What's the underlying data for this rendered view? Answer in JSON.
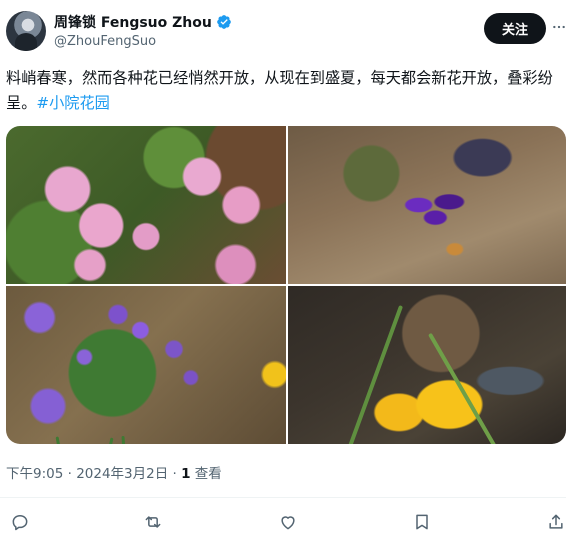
{
  "tweet": {
    "author": {
      "display_name": "周锋锁 Fengsuo Zhou",
      "handle": "@ZhouFengSuo",
      "verified": true
    },
    "follow_label": "关注",
    "text_before_hashtag": "料峭春寒，然而各种花已经悄然开放，从现在到盛夏，每天都会新花开放，叠彩纷呈。",
    "hashtag": "#小院花园",
    "media": [
      {
        "icon": "pink-hellebore-photo"
      },
      {
        "icon": "purple-crocus-photo"
      },
      {
        "icon": "purple-crocus-cluster-photo"
      },
      {
        "icon": "yellow-crocus-photo"
      }
    ],
    "timestamp": "下午9:05 · 2024年3月2日 · ",
    "views_count": "1",
    "views_label": " 查看"
  },
  "actions": [
    {
      "icon": "reply-icon"
    },
    {
      "icon": "retweet-icon"
    },
    {
      "icon": "like-icon"
    },
    {
      "icon": "bookmark-icon"
    },
    {
      "icon": "share-icon"
    }
  ],
  "colors": {
    "accent": "#1d9bf0",
    "follow_button_bg": "#0f1419",
    "muted_text": "#536471"
  }
}
